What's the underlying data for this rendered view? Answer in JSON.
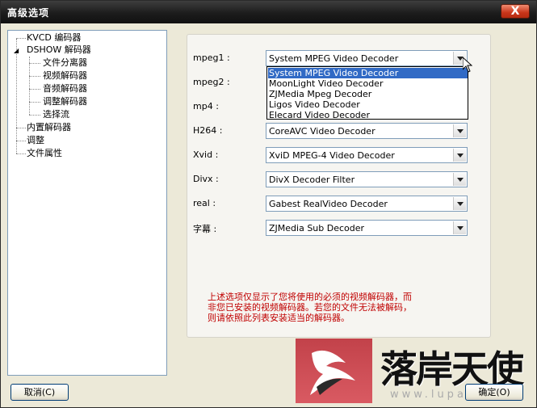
{
  "window": {
    "title": "高级选项",
    "close_label": "X"
  },
  "tree": {
    "items": [
      {
        "label": "KVCD 编码器",
        "level": 0
      },
      {
        "label": "DSHOW 解码器",
        "level": 0,
        "expanded": true
      },
      {
        "label": "文件分离器",
        "level": 1
      },
      {
        "label": "视频解码器",
        "level": 1
      },
      {
        "label": "音频解码器",
        "level": 1
      },
      {
        "label": "调整解码器",
        "level": 1
      },
      {
        "label": "选择流",
        "level": 1
      },
      {
        "label": "内置解码器",
        "level": 0
      },
      {
        "label": "调整",
        "level": 0
      },
      {
        "label": "文件属性",
        "level": 0
      }
    ]
  },
  "decoders": [
    {
      "label": "mpeg1 :",
      "value": "System MPEG Video Decoder"
    },
    {
      "label": "mpeg2 :",
      "value": ""
    },
    {
      "label": "mp4 :",
      "value": ""
    },
    {
      "label": "H264 :",
      "value": "CoreAVC Video Decoder"
    },
    {
      "label": "Xvid :",
      "value": "XviD MPEG-4 Video Decoder"
    },
    {
      "label": "Divx :",
      "value": "DivX Decoder Filter"
    },
    {
      "label": "real :",
      "value": "Gabest RealVideo Decoder"
    },
    {
      "label": "字幕 :",
      "value": "ZJMedia Sub Decoder"
    }
  ],
  "dropdown": {
    "selected": "System MPEG Video Decoder",
    "options": [
      "System MPEG Video Decoder",
      "MoonLight Video Decoder",
      "ZJMedia Mpeg Decoder",
      "Ligos Video Decoder",
      "Elecard Video Decoder"
    ]
  },
  "note": {
    "lines": [
      "上述选项仅显示了您将使用的必须的视频解码器，而",
      "非您已安装的视频解码器。若您的文件无法被解码，",
      "则请依照此列表安装适当的解码器。"
    ]
  },
  "buttons": {
    "cancel": "取消(C)",
    "ok": "确定(O)"
  },
  "watermark": {
    "name": "落岸天使",
    "url": "www.lupa.cn"
  },
  "colors": {
    "note_text": "#c00000",
    "selection": "#316ac5",
    "titlebar": "#1c1c1c",
    "watermark": "#c2424a"
  }
}
